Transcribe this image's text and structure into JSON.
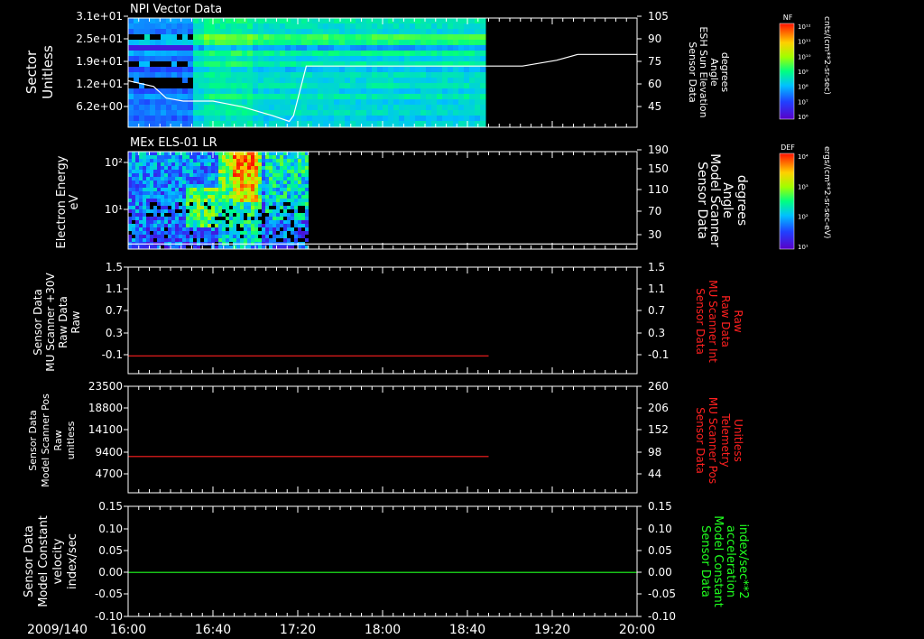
{
  "chart_data": [
    {
      "panel": 1,
      "type": "heatmap",
      "title": "NPI Vector Data",
      "ylabel_left": [
        "Sector",
        "Unitless"
      ],
      "yticks_left": [
        "3.1e+01",
        "2.5e+01",
        "1.9e+01",
        "1.2e+01",
        "6.2e+00"
      ],
      "ylabel_right": [
        "Sensor Data",
        "ESH Sun Elevation",
        "Angle",
        "degrees"
      ],
      "yticks_right": [
        "105",
        "90",
        "75",
        "60",
        "45"
      ],
      "ylim_right": [
        30,
        105
      ],
      "spectrogram_end_time": "18:48",
      "series": [
        {
          "name": "ESH Sun Elevation Angle",
          "color": "#ffffff",
          "points": [
            [
              "16:00",
              62
            ],
            [
              "16:12",
              58
            ],
            [
              "16:18",
              50
            ],
            [
              "16:26",
              48
            ],
            [
              "16:40",
              48
            ],
            [
              "16:54",
              44
            ],
            [
              "17:08",
              38
            ],
            [
              "17:16",
              34
            ],
            [
              "17:18",
              38
            ],
            [
              "17:24",
              72
            ],
            [
              "18:48",
              72
            ],
            [
              "19:06",
              72
            ],
            [
              "19:22",
              76
            ],
            [
              "19:32",
              80
            ],
            [
              "20:00",
              80
            ]
          ]
        }
      ]
    },
    {
      "panel": 2,
      "type": "heatmap",
      "title": "MEx ELS-01 LR",
      "ylabel_left": [
        "Electron Energy",
        "eV"
      ],
      "yticks_left": [
        "10²",
        "10¹"
      ],
      "ylabel_right": [
        "Sensor Data",
        "Model Scanner",
        "Angle",
        "degrees"
      ],
      "yticks_right": [
        "190",
        "150",
        "110",
        "70",
        "30"
      ],
      "ylim_right": [
        0,
        190
      ],
      "spectrogram_end_time": "17:24",
      "series": [
        {
          "name": "Model Scanner Angle",
          "color": "#ffffff",
          "points": [
            [
              "16:00",
              10
            ],
            [
              "20:00",
              10
            ]
          ]
        }
      ]
    },
    {
      "panel": 3,
      "type": "line",
      "ylabel_left": [
        "Sensor Data",
        "MU Scanner +30V",
        "Raw Data",
        "Raw"
      ],
      "yticks_left": [
        "1.5",
        "1.1",
        "0.7",
        "0.3",
        "-0.1"
      ],
      "ylim": [
        -0.3,
        1.5
      ],
      "ylabel_right": [
        "Sensor Data",
        "MU Scanner Int",
        "Raw Data",
        "Raw"
      ],
      "yticks_right": [
        "1.5",
        "1.1",
        "0.7",
        "0.3",
        "-0.1"
      ],
      "series": [
        {
          "name": "MU Scanner +30V Raw Data",
          "color": "#ff2020",
          "points": [
            [
              "16:00",
              0
            ],
            [
              "18:50",
              0
            ]
          ]
        }
      ]
    },
    {
      "panel": 4,
      "type": "line",
      "ylabel_left": [
        "Sensor Data",
        "Model Scanner Pos",
        "Raw",
        "unitless"
      ],
      "yticks_left": [
        "23500",
        "18800",
        "14100",
        "9400",
        "4700"
      ],
      "ylim": [
        0,
        23500
      ],
      "ylabel_right": [
        "Sensor Data",
        "MU Scanner Pos",
        "Telemetry",
        "Unitless"
      ],
      "yticks_right": [
        "260",
        "206",
        "152",
        "98",
        "44"
      ],
      "series": [
        {
          "name": "Model Scanner Pos Raw",
          "color": "#ff2020",
          "points": [
            [
              "16:00",
              8000
            ],
            [
              "18:50",
              8000
            ]
          ]
        }
      ]
    },
    {
      "panel": 5,
      "type": "line",
      "ylabel_left": [
        "Sensor Data",
        "Model Constant",
        "velocity",
        "index/sec"
      ],
      "yticks_left": [
        "0.15",
        "0.10",
        "0.05",
        "0.00",
        "-0.05",
        "-0.10"
      ],
      "ylim": [
        -0.1,
        0.15
      ],
      "ylabel_right": [
        "Sensor Data",
        "Model Constant",
        "acceleration",
        "index/sec**2"
      ],
      "yticks_right": [
        "0.15",
        "0.10",
        "0.05",
        "0.00",
        "-0.05",
        "-0.10"
      ],
      "series": [
        {
          "name": "Model Constant velocity",
          "color": "#20ff20",
          "points": [
            [
              "16:00",
              0
            ],
            [
              "20:00",
              0
            ]
          ]
        }
      ]
    }
  ],
  "x_axis": {
    "date_label": "2009/140",
    "ticks": [
      "16:00",
      "16:40",
      "17:20",
      "18:00",
      "18:40",
      "19:20",
      "20:00"
    ],
    "range": [
      "16:00",
      "20:00"
    ]
  },
  "colorbars": [
    {
      "name": "NF",
      "label": "cnts/(cm**2-sr-sec)",
      "ticks": [
        "10¹²",
        "10¹¹",
        "10¹⁰",
        "10⁹",
        "10⁸",
        "10⁷",
        "10⁶"
      ]
    },
    {
      "name": "DEF",
      "label": "ergs/(cm**2-sr-sec-eV)",
      "ticks": [
        "10⁴",
        "10³",
        "10²",
        "10¹"
      ]
    }
  ],
  "colors": {
    "right_label_panel3": "#ff2020",
    "right_label_panel4": "#ff2020",
    "right_label_panel5": "#20ff20"
  }
}
